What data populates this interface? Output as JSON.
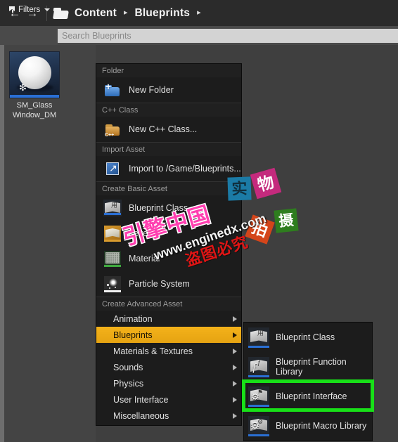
{
  "window": {
    "background_color": "#3f3f3f"
  },
  "toolbar": {
    "back_icon": "arrow-left-icon",
    "back_glyph": "←",
    "forward_icon": "arrow-right-icon",
    "forward_glyph": "→",
    "folder_icon": "folder-icon",
    "breadcrumb": [
      {
        "label": "Content",
        "separator": "▸"
      },
      {
        "label": "Blueprints",
        "separator": "▸"
      }
    ]
  },
  "filterbar": {
    "filters_label": "Filters",
    "funnel_icon": "funnel-icon",
    "caret_icon": "chevron-down-icon",
    "search_placeholder": "Search Blueprints",
    "search_value": ""
  },
  "asset_panel": {
    "assets": [
      {
        "name_line1": "SM_Glass",
        "name_line2": "Window_DM",
        "thumbnail_icon": "static-mesh-sphere-thumbnail",
        "sparkle_glyph": "❇",
        "type_bar_color": "#2a6fd4",
        "selected": true
      }
    ]
  },
  "context_menu": {
    "sections": [
      {
        "header": "Folder",
        "items": [
          {
            "label": "New Folder",
            "icon": "new-folder-icon",
            "submenu": false
          }
        ]
      },
      {
        "header": "C++ Class",
        "items": [
          {
            "label": "New C++ Class...",
            "icon": "new-cpp-class-icon",
            "submenu": false
          }
        ]
      },
      {
        "header": "Import Asset",
        "items": [
          {
            "label": "Import to /Game/Blueprints...",
            "icon": "import-asset-icon",
            "submenu": false
          }
        ]
      },
      {
        "header": "Create Basic Asset",
        "items": [
          {
            "label": "Blueprint Class",
            "icon": "blueprint-class-icon",
            "submenu": false
          },
          {
            "label": "Level",
            "icon": "level-icon",
            "submenu": false
          },
          {
            "label": "Material",
            "icon": "material-icon",
            "submenu": false
          },
          {
            "label": "Particle System",
            "icon": "particle-system-icon",
            "submenu": false
          }
        ]
      },
      {
        "header": "Create Advanced Asset",
        "items": [
          {
            "label": "Animation",
            "submenu": true,
            "highlighted": false
          },
          {
            "label": "Blueprints",
            "submenu": true,
            "highlighted": true
          },
          {
            "label": "Materials & Textures",
            "submenu": true,
            "highlighted": false
          },
          {
            "label": "Sounds",
            "submenu": true,
            "highlighted": false
          },
          {
            "label": "Physics",
            "submenu": true,
            "highlighted": false
          },
          {
            "label": "User Interface",
            "submenu": true,
            "highlighted": false
          },
          {
            "label": "Miscellaneous",
            "submenu": true,
            "highlighted": false
          }
        ]
      }
    ],
    "highlight_color": "#f0ab14",
    "submenu_arrow_icon": "chevron-right-icon"
  },
  "submenu": {
    "parent": "Blueprints",
    "items": [
      {
        "label": "Blueprint Class",
        "icon": "blueprint-class-icon",
        "glyph": "用",
        "highlighted": false
      },
      {
        "label": "Blueprint Function Library",
        "icon": "blueprint-function-library-icon",
        "glyph": "ƒ",
        "highlighted": false
      },
      {
        "label": "Blueprint Interface",
        "icon": "blueprint-interface-icon",
        "glyph": "⚑",
        "highlighted": true
      },
      {
        "label": "Blueprint Macro Library",
        "icon": "blueprint-macro-library-icon",
        "glyph": "⚙",
        "highlighted": false
      }
    ],
    "annotation_color": "#18e018"
  },
  "watermarks": [
    {
      "text": "引擎中国",
      "color": "#ff3fb0",
      "name": "watermark-brand-cn"
    },
    {
      "text": "www.enginedx.com",
      "color": "#f2f2f2",
      "name": "watermark-url"
    },
    {
      "text": "盗图必究",
      "color": "#e01515",
      "name": "watermark-warning-cn"
    }
  ],
  "stickers": [
    {
      "text": "实",
      "color": "#1b7ba6",
      "name": "sticker-shi"
    },
    {
      "text": "物",
      "color": "#c42a7d",
      "name": "sticker-wu"
    },
    {
      "text": "拍",
      "color": "#d4451a",
      "name": "sticker-pai"
    },
    {
      "text": "摄",
      "color": "#2e7d1e",
      "name": "sticker-she"
    }
  ]
}
